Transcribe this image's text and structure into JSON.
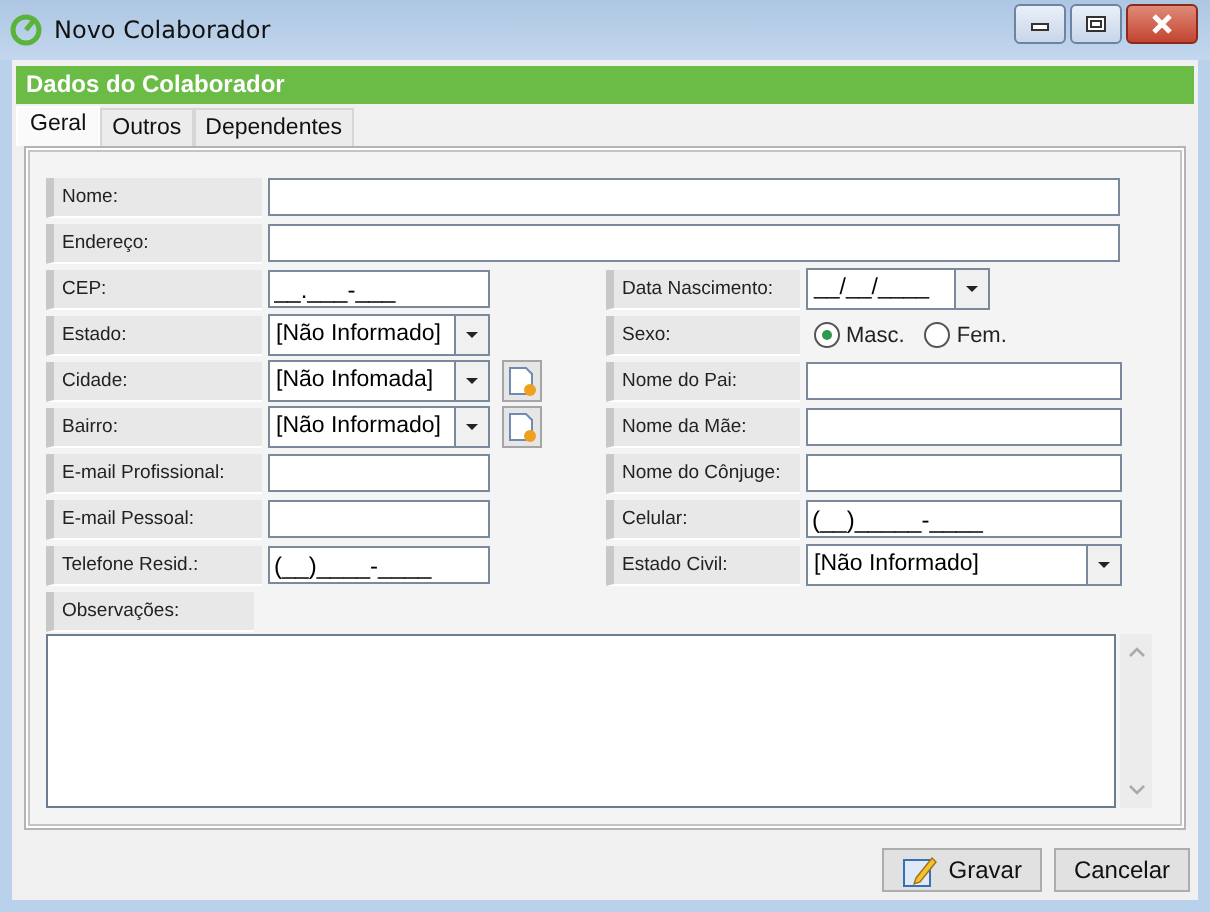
{
  "window": {
    "title": "Novo Colaborador"
  },
  "header": "Dados do Colaborador",
  "tabs": [
    {
      "label": "Geral",
      "selected": true
    },
    {
      "label": "Outros",
      "selected": false
    },
    {
      "label": "Dependentes",
      "selected": false
    }
  ],
  "form": {
    "full_rows": [
      {
        "label": "Nome:",
        "kind": "text"
      },
      {
        "label": "Endereço:",
        "kind": "text"
      }
    ],
    "left_rows": [
      {
        "label": "CEP:",
        "kind": "text",
        "value": "__.___-___"
      },
      {
        "label": "Estado:",
        "kind": "combo",
        "value": "[Não Informado]"
      },
      {
        "label": "Cidade:",
        "kind": "combo_add",
        "value": "[Não Infomada]"
      },
      {
        "label": "Bairro:",
        "kind": "combo_add",
        "value": "[Não Informado]"
      },
      {
        "label": "E-mail Profissional:",
        "kind": "text"
      },
      {
        "label": "E-mail Pessoal:",
        "kind": "text"
      },
      {
        "label": "Telefone Resid.:",
        "kind": "text",
        "value": "(__)____-____"
      }
    ],
    "right_rows": [
      {
        "label": "Data Nascimento:",
        "kind": "date",
        "value": "__/__/____"
      },
      {
        "label": "Sexo:",
        "kind": "radio",
        "options": [
          {
            "label": "Masc.",
            "selected": true
          },
          {
            "label": "Fem.",
            "selected": false
          }
        ]
      },
      {
        "label": "Nome do Pai:",
        "kind": "text"
      },
      {
        "label": "Nome da Mãe:",
        "kind": "text"
      },
      {
        "label": "Nome do Cônjuge:",
        "kind": "text"
      },
      {
        "label": "Celular:",
        "kind": "text",
        "value": "(__)_____-____"
      },
      {
        "label": "Estado Civil:",
        "kind": "combo",
        "value": "[Não Informado]"
      }
    ],
    "notes_label": "Observações:"
  },
  "buttons": [
    {
      "label": "Gravar",
      "kind": "icon"
    },
    {
      "label": "Cancelar",
      "kind": "plain"
    }
  ]
}
